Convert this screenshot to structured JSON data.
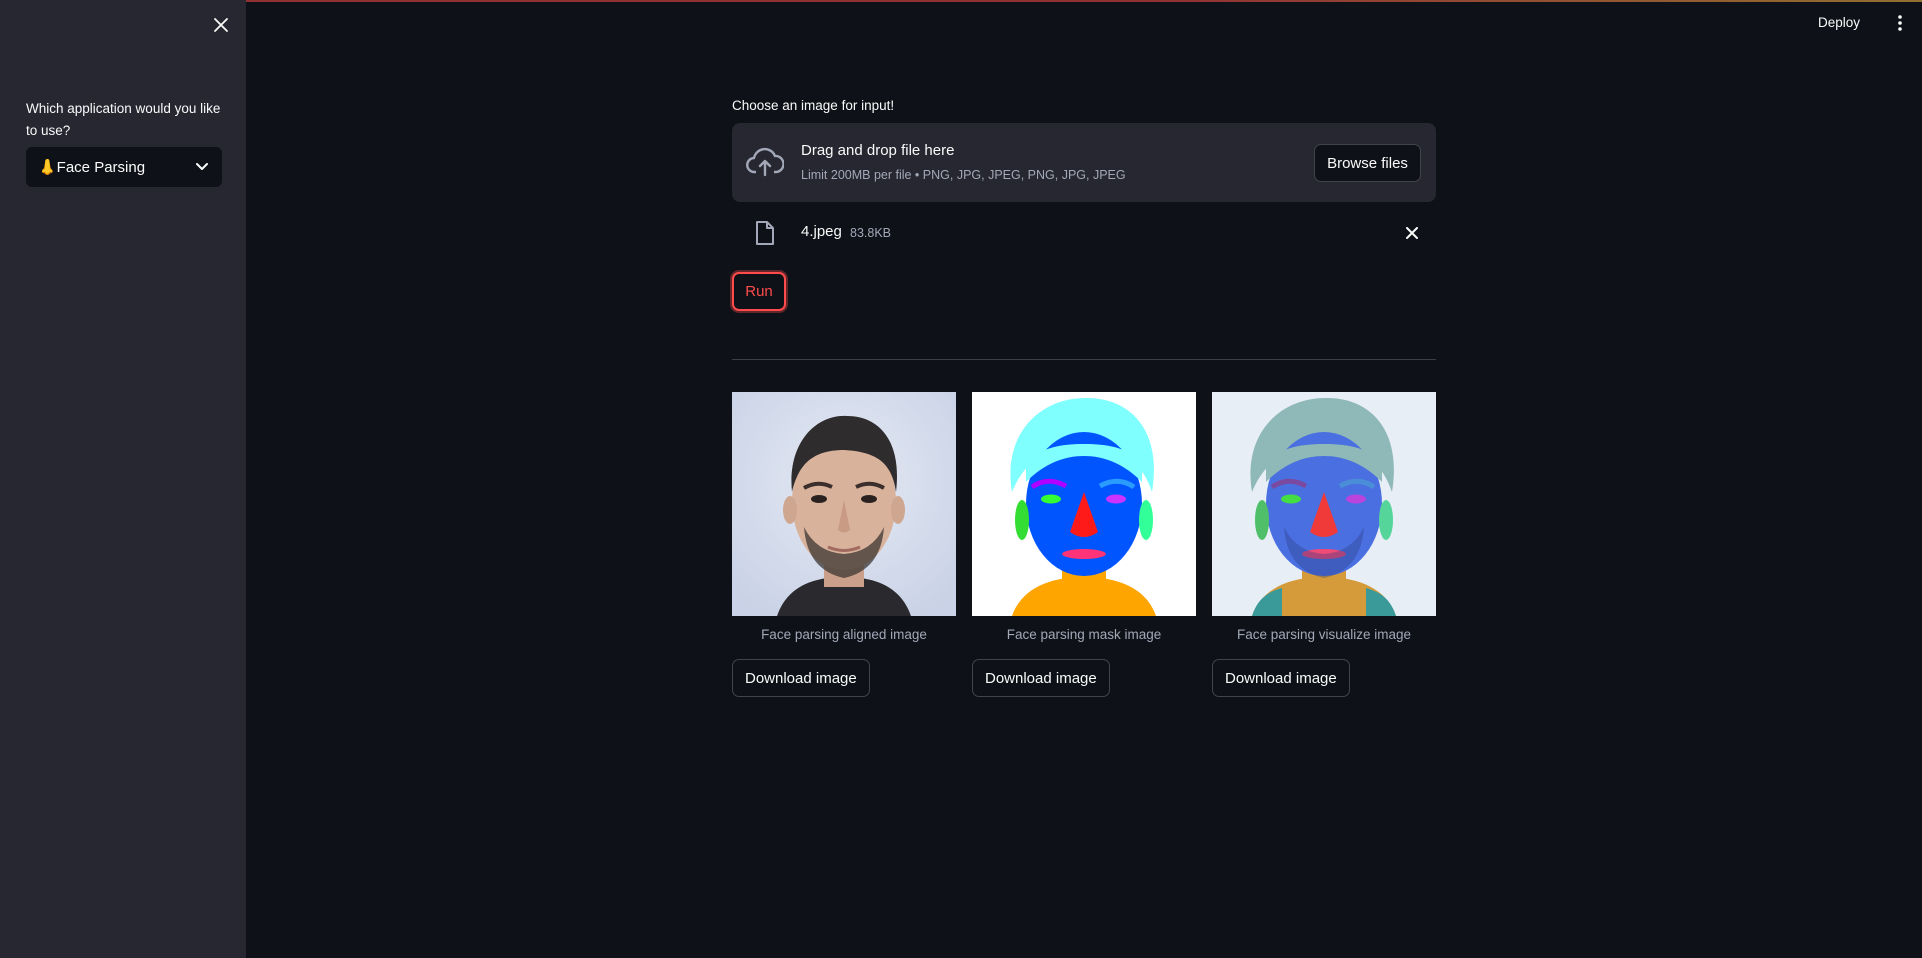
{
  "sidebar": {
    "question": "Which application would you like to use?",
    "selected": "👃Face Parsing"
  },
  "header": {
    "deploy": "Deploy"
  },
  "uploader": {
    "label": "Choose an image for input!",
    "drop_title": "Drag and drop file here",
    "limit": "Limit 200MB per file • PNG, JPG, JPEG, PNG, JPG, JPEG",
    "browse": "Browse files",
    "file_name": "4.jpeg",
    "file_size": "83.8KB"
  },
  "run_label": "Run",
  "results": [
    {
      "caption": "Face parsing aligned image",
      "button": "Download image"
    },
    {
      "caption": "Face parsing mask image",
      "button": "Download image"
    },
    {
      "caption": "Face parsing visualize image",
      "button": "Download image"
    }
  ],
  "colors": {
    "background": "#0e1117",
    "sidebar": "#262730",
    "accent": "#ff4b4b",
    "muted_text": "#a3a8b8"
  }
}
